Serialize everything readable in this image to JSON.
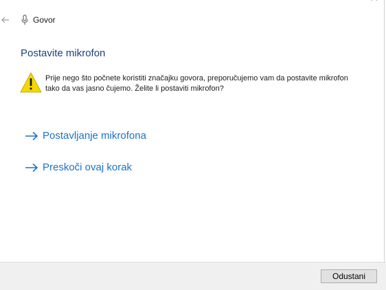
{
  "window": {
    "title": "Govor"
  },
  "page": {
    "heading": "Postavite mikrofon",
    "warning_text": "Prije nego što počnete koristiti značajku govora, preporučujemo vam da postavite mikrofon tako da vas jasno čujemo. Želite li postaviti mikrofon?"
  },
  "links": [
    {
      "label": "Postavljanje mikrofona"
    },
    {
      "label": "Preskoči ovaj korak"
    }
  ],
  "footer": {
    "cancel_label": "Odustani"
  },
  "colors": {
    "heading": "#1f3f7a",
    "link": "#1a72c9",
    "warning_fill": "#f5d800"
  },
  "icons": {
    "back": "arrow-left-icon",
    "title": "microphone-icon",
    "warning": "warning-icon",
    "link": "arrow-right-icon",
    "close": "close-icon"
  }
}
